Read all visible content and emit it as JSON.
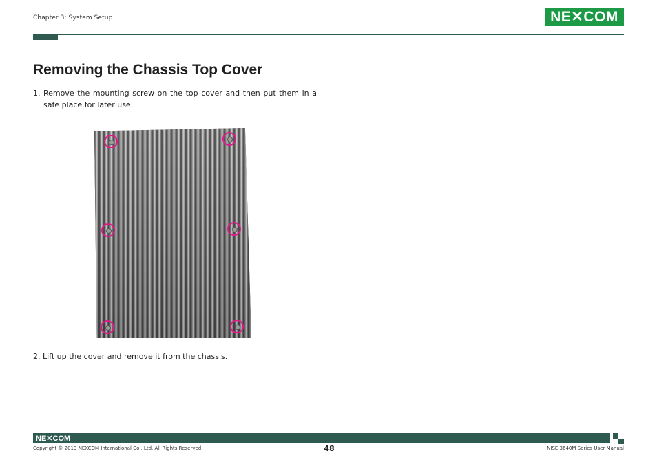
{
  "header": {
    "chapter": "Chapter 3: System Setup",
    "logo": "NE✕COM",
    "accent_color": "#2e5a4f",
    "logo_color": "#1d9a46"
  },
  "title": "Removing the Chassis Top Cover",
  "steps": [
    {
      "number": "1.",
      "text": "Remove the mounting screw on the top cover and then put them in a safe place for later use."
    },
    {
      "number": "2.",
      "text": "Lift up the cover and remove it from the chassis."
    }
  ],
  "photo": {
    "highlight_color": "#e0198a"
  },
  "footer": {
    "logo": "NE✕COM",
    "copyright": "Copyright © 2013 NEXCOM International Co., Ltd. All Rights Reserved.",
    "page_number": "48",
    "manual": "NISE 3640M Series User Manual"
  }
}
